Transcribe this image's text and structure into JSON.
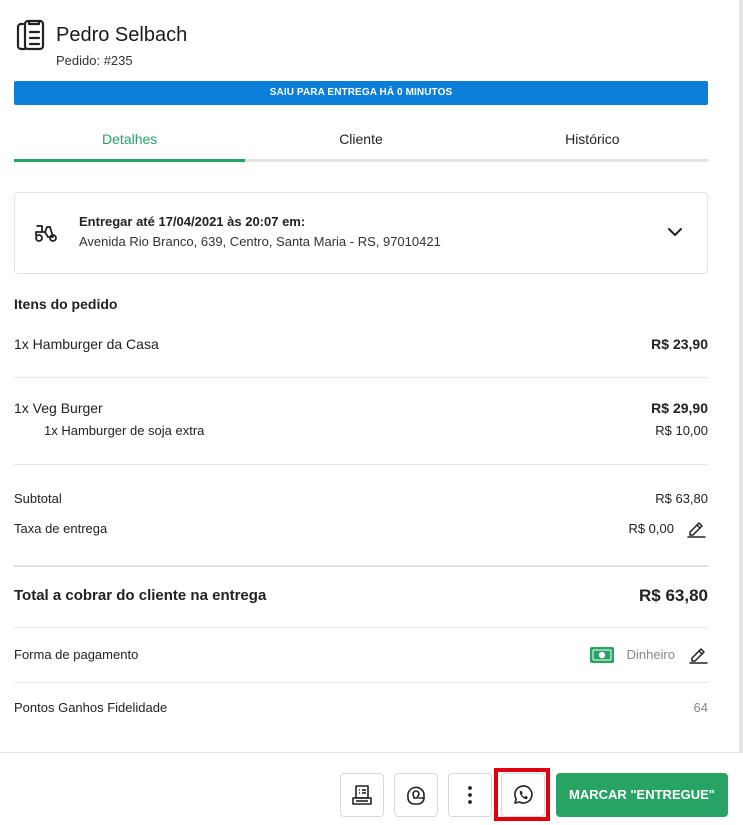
{
  "header": {
    "customer_name": "Pedro Selbach",
    "order_number": "Pedido: #235",
    "icon": "clipboard-list-icon"
  },
  "status_banner": {
    "text": "SAIU PARA ENTREGA HÁ 0 MINUTOS",
    "color": "#0b7ed8"
  },
  "tabs": [
    {
      "label": "Detalhes",
      "active": true
    },
    {
      "label": "Cliente",
      "active": false
    },
    {
      "label": "Histórico",
      "active": false
    }
  ],
  "delivery": {
    "icon": "delivery-scooter-icon",
    "title": "Entregar até 17/04/2021 às 20:07 em:",
    "address": "Avenida Rio Branco, 639, Centro, Santa Maria - RS, 97010421"
  },
  "items_section": {
    "title": "Itens do pedido",
    "items": [
      {
        "name": "1x Hamburger da Casa",
        "price": "R$ 23,90",
        "extras": []
      },
      {
        "name": "1x Veg Burger",
        "price": "R$ 29,90",
        "extras": [
          {
            "name": "1x Hamburger de soja extra",
            "price": "R$ 10,00"
          }
        ]
      }
    ]
  },
  "summary": {
    "subtotal_label": "Subtotal",
    "subtotal_value": "R$ 63,80",
    "delivery_fee_label": "Taxa de entrega",
    "delivery_fee_value": "R$ 0,00",
    "total_label": "Total a cobrar do cliente na entrega",
    "total_value": "R$ 63,80"
  },
  "payment": {
    "label": "Forma de pagamento",
    "method": "Dinheiro",
    "icon": "cash-icon"
  },
  "loyalty": {
    "label": "Pontos Ganhos Fidelidade",
    "value": "64"
  },
  "footer": {
    "buttons": [
      {
        "icon": "receipt-printer-icon"
      },
      {
        "icon": "helmet-icon"
      },
      {
        "icon": "more-vertical-icon"
      },
      {
        "icon": "whatsapp-icon"
      }
    ],
    "primary_label": "MARCAR \"ENTREGUE\"",
    "accent_color": "#27a364",
    "highlight_color": "#e0000d"
  }
}
